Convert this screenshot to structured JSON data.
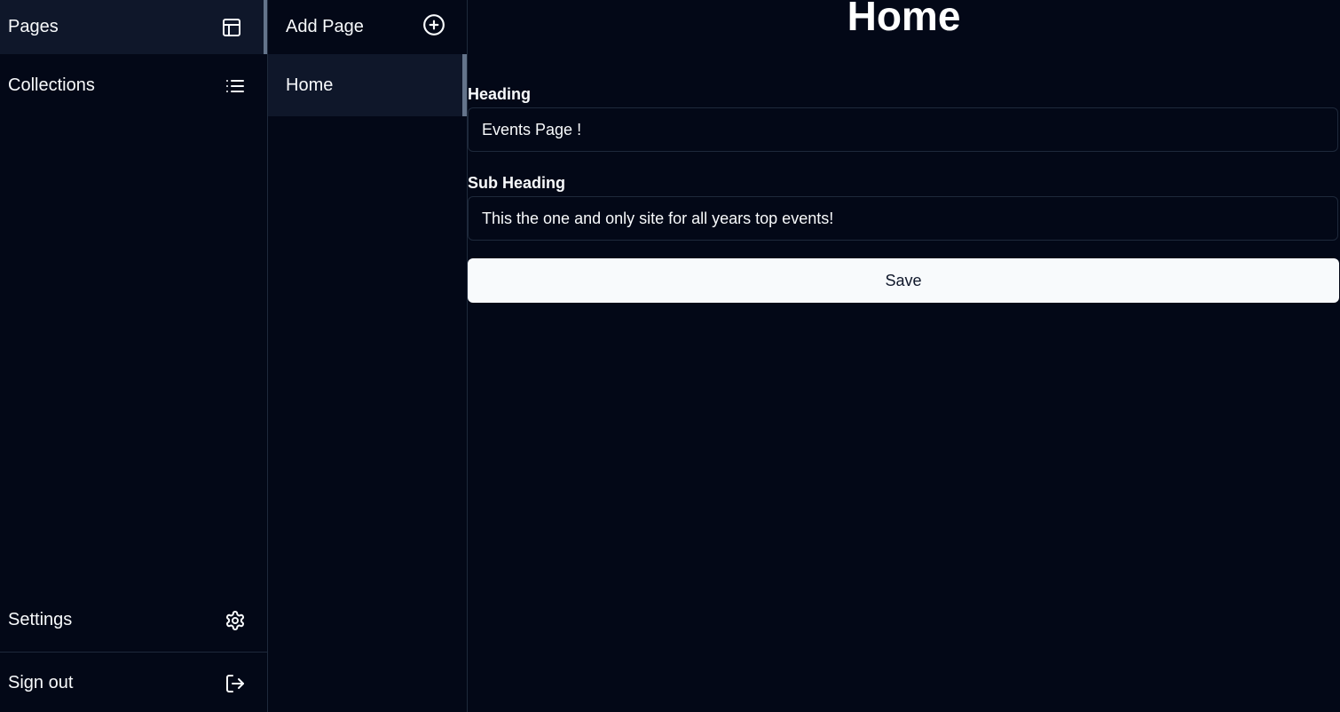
{
  "sidebar": {
    "items": [
      {
        "label": "Pages",
        "icon": "layout-icon",
        "active": true
      },
      {
        "label": "Collections",
        "icon": "list-icon",
        "active": false
      }
    ],
    "footer": [
      {
        "label": "Settings",
        "icon": "gear-icon"
      },
      {
        "label": "Sign out",
        "icon": "sign-out-icon"
      }
    ]
  },
  "pages_panel": {
    "add_label": "Add Page",
    "add_icon": "plus-circle-icon",
    "pages": [
      {
        "label": "Home",
        "selected": true
      }
    ]
  },
  "main": {
    "title": "Home",
    "fields": [
      {
        "label": "Heading",
        "value": "Events Page !"
      },
      {
        "label": "Sub Heading",
        "value": "This the one and only site for all years top events!"
      }
    ],
    "save_label": "Save"
  },
  "colors": {
    "background": "#030817",
    "active_item": "#0f172a",
    "border": "#1e293b",
    "accent_bar": "#64748b",
    "button_bg": "#f8fafc",
    "button_text": "#0f172a"
  }
}
